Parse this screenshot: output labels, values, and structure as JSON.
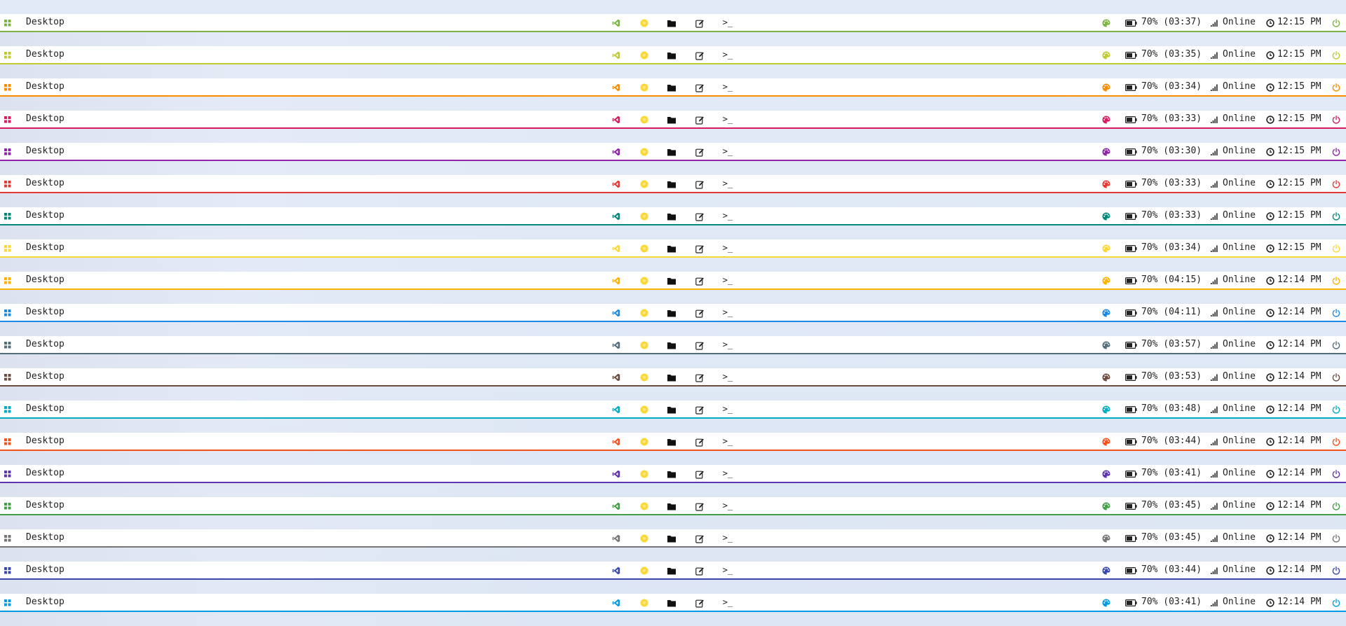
{
  "bars": [
    {
      "accent": "#7cb342",
      "desktop_label": "Desktop",
      "battery_text": "70% (03:37)",
      "network_text": "Online",
      "time_text": "12:15 PM"
    },
    {
      "accent": "#c0ca33",
      "desktop_label": "Desktop",
      "battery_text": "70% (03:35)",
      "network_text": "Online",
      "time_text": "12:15 PM"
    },
    {
      "accent": "#fb8c00",
      "desktop_label": "Desktop",
      "battery_text": "70% (03:34)",
      "network_text": "Online",
      "time_text": "12:15 PM"
    },
    {
      "accent": "#d81b60",
      "desktop_label": "Desktop",
      "battery_text": "70% (03:33)",
      "network_text": "Online",
      "time_text": "12:15 PM"
    },
    {
      "accent": "#8e24aa",
      "desktop_label": "Desktop",
      "battery_text": "70% (03:30)",
      "network_text": "Online",
      "time_text": "12:15 PM"
    },
    {
      "accent": "#e53935",
      "desktop_label": "Desktop",
      "battery_text": "70% (03:33)",
      "network_text": "Online",
      "time_text": "12:15 PM"
    },
    {
      "accent": "#00897b",
      "desktop_label": "Desktop",
      "battery_text": "70% (03:33)",
      "network_text": "Online",
      "time_text": "12:15 PM"
    },
    {
      "accent": "#fdd835",
      "desktop_label": "Desktop",
      "battery_text": "70% (03:34)",
      "network_text": "Online",
      "time_text": "12:15 PM"
    },
    {
      "accent": "#ffb300",
      "desktop_label": "Desktop",
      "battery_text": "70% (04:15)",
      "network_text": "Online",
      "time_text": "12:14 PM"
    },
    {
      "accent": "#1e88e5",
      "desktop_label": "Desktop",
      "battery_text": "70% (04:11)",
      "network_text": "Online",
      "time_text": "12:14 PM"
    },
    {
      "accent": "#546e7a",
      "desktop_label": "Desktop",
      "battery_text": "70% (03:57)",
      "network_text": "Online",
      "time_text": "12:14 PM"
    },
    {
      "accent": "#6d4c41",
      "desktop_label": "Desktop",
      "battery_text": "70% (03:53)",
      "network_text": "Online",
      "time_text": "12:14 PM"
    },
    {
      "accent": "#00acc1",
      "desktop_label": "Desktop",
      "battery_text": "70% (03:48)",
      "network_text": "Online",
      "time_text": "12:14 PM"
    },
    {
      "accent": "#f4511e",
      "desktop_label": "Desktop",
      "battery_text": "70% (03:44)",
      "network_text": "Online",
      "time_text": "12:14 PM"
    },
    {
      "accent": "#5e35b1",
      "desktop_label": "Desktop",
      "battery_text": "70% (03:41)",
      "network_text": "Online",
      "time_text": "12:14 PM"
    },
    {
      "accent": "#43a047",
      "desktop_label": "Desktop",
      "battery_text": "70% (03:45)",
      "network_text": "Online",
      "time_text": "12:14 PM"
    },
    {
      "accent": "#757575",
      "desktop_label": "Desktop",
      "battery_text": "70% (03:45)",
      "network_text": "Online",
      "time_text": "12:14 PM"
    },
    {
      "accent": "#3949ab",
      "desktop_label": "Desktop",
      "battery_text": "70% (03:44)",
      "network_text": "Online",
      "time_text": "12:14 PM"
    },
    {
      "accent": "#039be5",
      "desktop_label": "Desktop",
      "battery_text": "70% (03:41)",
      "network_text": "Online",
      "time_text": "12:14 PM"
    }
  ],
  "launcher_icons": [
    "vscode-icon",
    "web-browser-icon",
    "folder-icon",
    "text-editor-icon",
    "terminal-icon"
  ],
  "terminal_glyph": ">_",
  "web_icon_color": "#fdd835",
  "battery_level": 0.7
}
